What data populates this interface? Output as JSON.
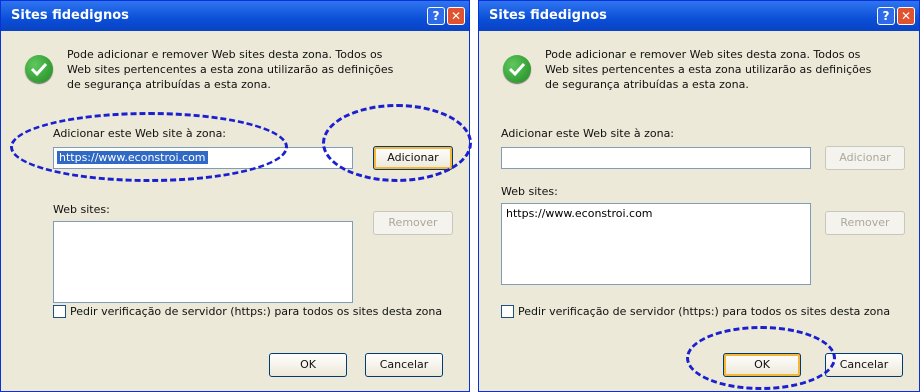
{
  "left": {
    "title": "Sites fidedignos",
    "info": "Pode adicionar e remover Web sites desta zona. Todos os Web sites pertencentes a esta zona utilizarão as definições de segurança atribuídas a esta zona.",
    "add_label": "Adicionar este Web site à zona:",
    "add_value": "https://www.econstroi.com",
    "add_button": "Adicionar",
    "websites_label": "Web sites:",
    "websites": [],
    "remove_button": "Remover",
    "checkbox_label": "Pedir verificação de servidor (https:) para todos os sites desta zona",
    "ok_button": "OK",
    "cancel_button": "Cancelar"
  },
  "right": {
    "title": "Sites fidedignos",
    "info": "Pode adicionar e remover Web sites desta zona. Todos os Web sites pertencentes a esta zona utilizarão as definições de segurança atribuídas a esta zona.",
    "add_label": "Adicionar este Web site à zona:",
    "add_value": "",
    "add_button": "Adicionar",
    "websites_label": "Web sites:",
    "websites": [
      "https://www.econstroi.com"
    ],
    "remove_button": "Remover",
    "checkbox_label": "Pedir verificação de servidor (https:) para todos os sites desta zona",
    "ok_button": "OK",
    "cancel_button": "Cancelar"
  },
  "icons": {
    "help": "help-icon",
    "close": "close-icon",
    "info": "checkmark-icon"
  }
}
